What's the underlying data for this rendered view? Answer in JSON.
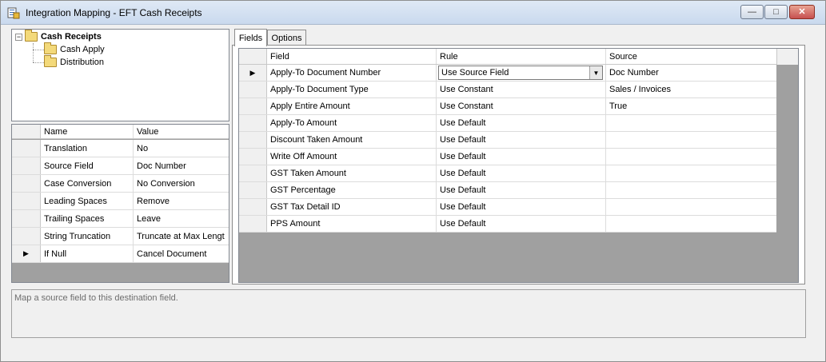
{
  "window": {
    "title": "Integration Mapping - EFT Cash Receipts",
    "icon": "integration-mapping-icon",
    "controls": {
      "minimize": "—",
      "maximize": "□",
      "close": "✕"
    }
  },
  "tree": {
    "root": {
      "label": "Cash Receipts",
      "expander": "−"
    },
    "children": [
      {
        "label": "Cash Apply"
      },
      {
        "label": "Distribution"
      }
    ]
  },
  "properties": {
    "columns": {
      "name": "Name",
      "value": "Value"
    },
    "rows": [
      {
        "name": "Translation",
        "value": "No"
      },
      {
        "name": "Source Field",
        "value": "Doc Number"
      },
      {
        "name": "Case Conversion",
        "value": "No Conversion"
      },
      {
        "name": "Leading Spaces",
        "value": "Remove"
      },
      {
        "name": "Trailing Spaces",
        "value": "Leave"
      },
      {
        "name": "String Truncation",
        "value": "Truncate at Max Lengt"
      },
      {
        "name": "If Null",
        "value": "Cancel Document",
        "current": "▶"
      }
    ]
  },
  "tabs": [
    {
      "label": "Fields",
      "active": true
    },
    {
      "label": "Options",
      "active": false
    }
  ],
  "fields": {
    "columns": {
      "field": "Field",
      "rule": "Rule",
      "source": "Source"
    },
    "current_marker": "▶",
    "combo_arrow": "▼",
    "rows": [
      {
        "field": "Apply-To Document Number",
        "rule": "Use Source Field",
        "source": "Doc Number"
      },
      {
        "field": "Apply-To Document Type",
        "rule": "Use Constant",
        "source": "Sales / Invoices"
      },
      {
        "field": "Apply Entire Amount",
        "rule": "Use Constant",
        "source": "True"
      },
      {
        "field": "Apply-To Amount",
        "rule": "Use Default",
        "source": ""
      },
      {
        "field": "Discount Taken Amount",
        "rule": "Use Default",
        "source": ""
      },
      {
        "field": "Write Off Amount",
        "rule": "Use Default",
        "source": ""
      },
      {
        "field": "GST Taken Amount",
        "rule": "Use Default",
        "source": ""
      },
      {
        "field": "GST Percentage",
        "rule": "Use Default",
        "source": ""
      },
      {
        "field": "GST Tax Detail ID",
        "rule": "Use Default",
        "source": ""
      },
      {
        "field": "PPS Amount",
        "rule": "Use Default",
        "source": ""
      }
    ]
  },
  "help": {
    "text": "Map a source field to this destination field."
  }
}
